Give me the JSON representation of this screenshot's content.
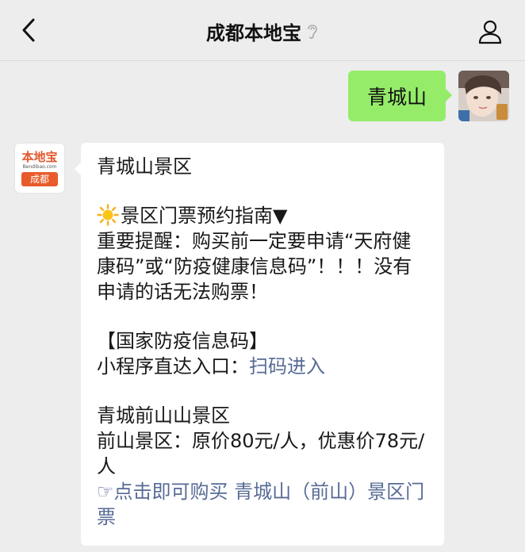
{
  "navbar": {
    "title": "成都本地宝",
    "back_icon": "chevron-left-icon",
    "ear_icon": "ear-icon",
    "profile_icon": "person-icon"
  },
  "outgoing": {
    "text": "青城山"
  },
  "incoming": {
    "avatar": {
      "logo_top": "本地宝",
      "logo_mid": "Bendibao.com",
      "logo_bottom": "成都"
    },
    "lines": {
      "l1": "青城山景区",
      "l2": "景区门票预约指南▼",
      "l3": "重要提醒：购买前一定要申请“天府健康码”或“防疫健康信息码”！！！没有申请的话无法购票！",
      "l4": "【国家防疫信息码】",
      "l5_prefix": "小程序直达入口：",
      "l5_link": "扫码进入",
      "l6": "青城前山山景区",
      "l7": "前山景区：原价80元/人，优惠价78元/人",
      "l8_link": "☞点击即可购买 青城山（前山）景区门票"
    }
  },
  "colors": {
    "background": "#ededed",
    "outgoing_bubble": "#95ec69",
    "incoming_bubble": "#ffffff",
    "link": "#576b95"
  }
}
